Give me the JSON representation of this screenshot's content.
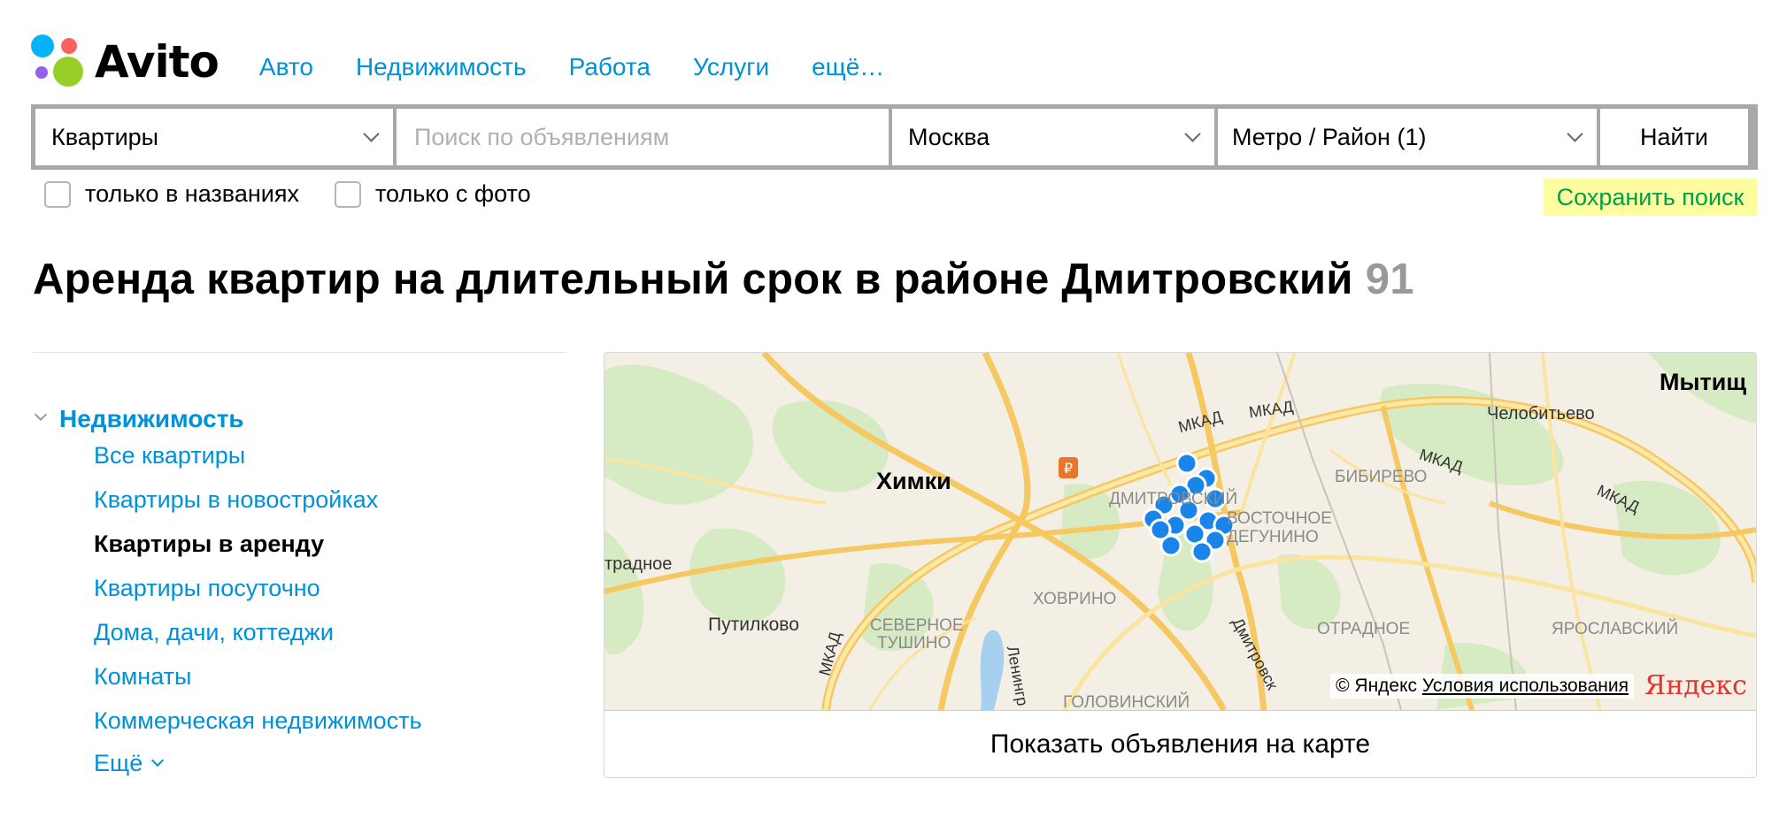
{
  "brand": {
    "name": "Avito"
  },
  "nav": [
    {
      "label": "Авто"
    },
    {
      "label": "Недвижимость"
    },
    {
      "label": "Работа"
    },
    {
      "label": "Услуги"
    },
    {
      "label": "ещё…"
    }
  ],
  "search": {
    "category": "Квартиры",
    "query_placeholder": "Поиск по объявлениям",
    "city": "Москва",
    "metro": "Метро / Район (1)",
    "find_label": "Найти"
  },
  "filters": {
    "titles_only_label": "только в названиях",
    "with_photo_label": "только с фото",
    "save_search_label": "Сохранить поиск"
  },
  "page": {
    "title": "Аренда квартир на длительный срок в районе Дмитровский",
    "count": "91"
  },
  "sidebar": {
    "category": "Недвижимость",
    "items": [
      {
        "label": "Все квартиры"
      },
      {
        "label": "Квартиры в новостройках"
      },
      {
        "label": "Квартиры в аренду"
      },
      {
        "label": "Квартиры посуточно"
      },
      {
        "label": "Дома, дачи, коттеджи"
      },
      {
        "label": "Комнаты"
      },
      {
        "label": "Коммерческая недвижимость"
      }
    ],
    "more_label": "Ещё"
  },
  "map": {
    "labels": {
      "khimki": "Химки",
      "mytishchi": "Мытищ",
      "chelobityevo": "Челобитьево",
      "bibirevo": "БИБИРЕВО",
      "mkad1": "МКАД",
      "mkad2": "МКАД",
      "mkad3": "МКАД",
      "mkad4": "МКАД",
      "mkad5": "МКАД",
      "dmitrovsky": "ДМИТРОВСКИЙ",
      "vostochnoe": "ВОСТОЧНОЕ",
      "degunino": "ДЕГУНИНО",
      "otradnoe_left": "традное",
      "putilkovo": "Путилково",
      "severnoe": "СЕВЕРНОЕ",
      "tushino": "ТУШИНО",
      "khovrino": "ХОВРИНО",
      "otradnoe": "ОТРАДНОЕ",
      "yaroslavsky": "ЯРОСЛАВСКИЙ",
      "dmitrovskoe_sh": "Дмитровск",
      "leningr": "Ленингр",
      "golovinsky": "ГОЛОВИНСКИЙ"
    },
    "copyright": "© Яндекс",
    "terms_link": "Условия использования",
    "provider_logo": "Яндекс",
    "show_on_map_label": "Показать объявления на карте"
  }
}
